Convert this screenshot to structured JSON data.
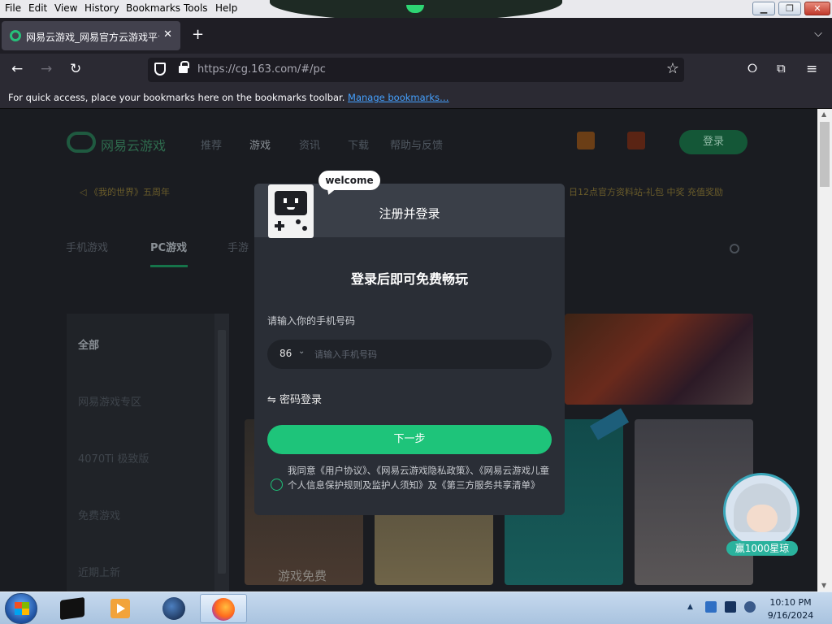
{
  "menubar": {
    "items": [
      "File",
      "Edit",
      "View",
      "History",
      "Bookmarks",
      "Tools",
      "Help"
    ]
  },
  "tab": {
    "title": "网易云游戏_网易官方云游戏平台",
    "close": "✕",
    "new_tab": "+",
    "list_tabs": "⌄"
  },
  "navbar": {
    "url_host": "https://cg.163.com",
    "url_path": "/#/pc",
    "back": "←",
    "forward": "→",
    "reload": "↻",
    "star": "☆"
  },
  "bookmarks_bar": {
    "message": "For quick access, place your bookmarks here on the bookmarks toolbar.",
    "link": "Manage bookmarks…"
  },
  "site": {
    "name": "网易云游戏",
    "nav": [
      "推荐",
      "游戏",
      "资讯",
      "下载",
      "帮助与反馈"
    ],
    "login": "登录",
    "notice_left": "◁ 《我的世界》五周年",
    "notice_right": "日12点官方资料站-礼包 中奖 充值奖励",
    "categories": [
      "手机游戏",
      "PC游戏",
      "手游"
    ],
    "sidebar": [
      "全部",
      "网易游戏专区",
      "4070Ti 极致版",
      "免费游戏",
      "近期上新"
    ],
    "card1_label": "游戏免费"
  },
  "modal": {
    "welcome": "welcome",
    "title": "注册并登录",
    "headline": "登录后即可免费畅玩",
    "phone_label": "请输入你的手机号码",
    "country_code": "86",
    "phone_placeholder": "请输入手机号码",
    "password_login": "⇋ 密码登录",
    "next_button": "下一步",
    "agreement": "我同意《用户协议》、《网易云游戏隐私政策》、《网易云游戏儿童个人信息保护规则及监护人须知》及《第三方服务共享清单》"
  },
  "promo": {
    "label": "赢1000星琼"
  },
  "taskbar": {
    "time": "10:10 PM",
    "date": "9/16/2024"
  },
  "colors": {
    "accent_green": "#1ec47a",
    "modal_bg": "#2a2e36",
    "link_blue": "#45a1ff"
  }
}
